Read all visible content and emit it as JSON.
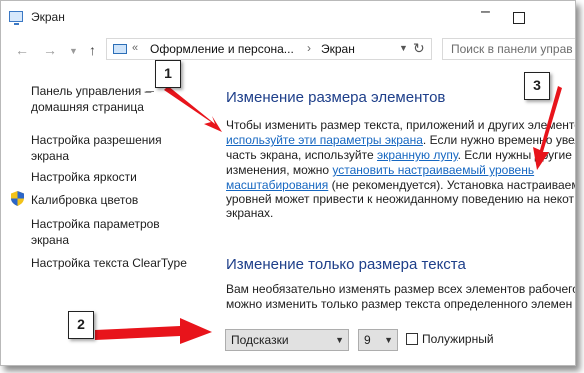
{
  "window": {
    "title": "Экран"
  },
  "address": {
    "crumb_prefix": "«",
    "crumb_1": "Оформление и персона...",
    "crumb_sep": "›",
    "crumb_2": "Экран"
  },
  "search": {
    "placeholder": "Поиск в панели управ"
  },
  "sidebar": {
    "home": [
      "Панель управления –",
      "домашняя страница"
    ],
    "items": [
      [
        "Настройка разрешения",
        "экрана"
      ],
      [
        "Настройка яркости"
      ],
      [
        "Калибровка цветов"
      ],
      [
        "Настройка параметров",
        "экрана"
      ],
      [
        "Настройка текста ClearType"
      ]
    ]
  },
  "main": {
    "heading_1": "Изменение размера элементов",
    "p1": "Чтобы изменить размер текста, приложений и других элементов",
    "p2_link": "используйте эти параметры экрана",
    "p2_text": ". Если нужно временно увел",
    "p3_text": "часть экрана, используйте ",
    "p3_link": "экранную лупу",
    "p3_text2": ". Если нужны другие",
    "p4_text": "изменения, можно ",
    "p4_link": "установить настраиваемый уровень",
    "p5_link": "масштабирования",
    "p5_text": " (не рекомендуется). Установка настраиваем",
    "p6": "уровней может привести к неожиданному поведению на некот",
    "p7": "экранах.",
    "heading_2": "Изменение только размера текста",
    "q1": "Вам необязательно изменять размер всех элементов рабочего",
    "q2": "можно изменить только размер текста определенного элемен"
  },
  "controls": {
    "item_select": "Подсказки",
    "size_select": "9",
    "bold_label": "Полужирный",
    "bold_checked": false
  },
  "annotations": {
    "marker_1": "1",
    "marker_2": "2",
    "marker_3": "3",
    "arrow_color": "#e8141b"
  }
}
